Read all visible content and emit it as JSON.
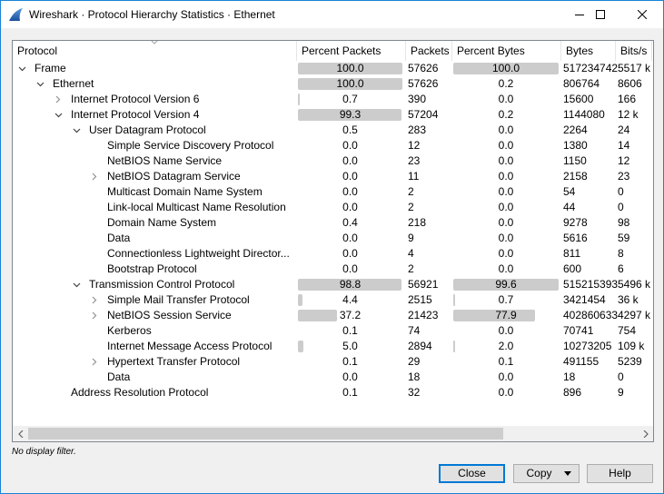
{
  "window": {
    "title": "Wireshark · Protocol Hierarchy Statistics · Ethernet",
    "app_icon": "wireshark-fin-icon",
    "accent_color": "#0078d7"
  },
  "table": {
    "columns": [
      "Protocol",
      "Percent Packets",
      "Packets",
      "Percent Bytes",
      "Bytes",
      "Bits/s"
    ],
    "rows": [
      {
        "level": 0,
        "expander": "expanded",
        "protocol": "Frame",
        "pct_packets": "100.0",
        "pct_packets_value": 100.0,
        "packets": "57626",
        "pct_bytes": "100.0",
        "pct_bytes_value": 100.0,
        "bytes": "517234742",
        "bits_s": "5517 k"
      },
      {
        "level": 1,
        "expander": "expanded",
        "protocol": "Ethernet",
        "pct_packets": "100.0",
        "pct_packets_value": 100.0,
        "packets": "57626",
        "pct_bytes": "0.2",
        "pct_bytes_value": 0.2,
        "bytes": "806764",
        "bits_s": "8606"
      },
      {
        "level": 2,
        "expander": "collapsed",
        "protocol": "Internet Protocol Version 6",
        "pct_packets": "0.7",
        "pct_packets_value": 0.7,
        "packets": "390",
        "pct_bytes": "0.0",
        "pct_bytes_value": 0.0,
        "bytes": "15600",
        "bits_s": "166"
      },
      {
        "level": 2,
        "expander": "expanded",
        "protocol": "Internet Protocol Version 4",
        "pct_packets": "99.3",
        "pct_packets_value": 99.3,
        "packets": "57204",
        "pct_bytes": "0.2",
        "pct_bytes_value": 0.2,
        "bytes": "1144080",
        "bits_s": "12 k"
      },
      {
        "level": 3,
        "expander": "expanded",
        "protocol": "User Datagram Protocol",
        "pct_packets": "0.5",
        "pct_packets_value": 0.5,
        "packets": "283",
        "pct_bytes": "0.0",
        "pct_bytes_value": 0.0,
        "bytes": "2264",
        "bits_s": "24"
      },
      {
        "level": 4,
        "expander": "none",
        "protocol": "Simple Service Discovery Protocol",
        "pct_packets": "0.0",
        "pct_packets_value": 0.0,
        "packets": "12",
        "pct_bytes": "0.0",
        "pct_bytes_value": 0.0,
        "bytes": "1380",
        "bits_s": "14"
      },
      {
        "level": 4,
        "expander": "none",
        "protocol": "NetBIOS Name Service",
        "pct_packets": "0.0",
        "pct_packets_value": 0.0,
        "packets": "23",
        "pct_bytes": "0.0",
        "pct_bytes_value": 0.0,
        "bytes": "1150",
        "bits_s": "12"
      },
      {
        "level": 4,
        "expander": "collapsed",
        "protocol": "NetBIOS Datagram Service",
        "pct_packets": "0.0",
        "pct_packets_value": 0.0,
        "packets": "11",
        "pct_bytes": "0.0",
        "pct_bytes_value": 0.0,
        "bytes": "2158",
        "bits_s": "23"
      },
      {
        "level": 4,
        "expander": "none",
        "protocol": "Multicast Domain Name System",
        "pct_packets": "0.0",
        "pct_packets_value": 0.0,
        "packets": "2",
        "pct_bytes": "0.0",
        "pct_bytes_value": 0.0,
        "bytes": "54",
        "bits_s": "0"
      },
      {
        "level": 4,
        "expander": "none",
        "protocol": "Link-local Multicast Name Resolution",
        "pct_packets": "0.0",
        "pct_packets_value": 0.0,
        "packets": "2",
        "pct_bytes": "0.0",
        "pct_bytes_value": 0.0,
        "bytes": "44",
        "bits_s": "0"
      },
      {
        "level": 4,
        "expander": "none",
        "protocol": "Domain Name System",
        "pct_packets": "0.4",
        "pct_packets_value": 0.4,
        "packets": "218",
        "pct_bytes": "0.0",
        "pct_bytes_value": 0.0,
        "bytes": "9278",
        "bits_s": "98"
      },
      {
        "level": 4,
        "expander": "none",
        "protocol": "Data",
        "pct_packets": "0.0",
        "pct_packets_value": 0.0,
        "packets": "9",
        "pct_bytes": "0.0",
        "pct_bytes_value": 0.0,
        "bytes": "5616",
        "bits_s": "59"
      },
      {
        "level": 4,
        "expander": "none",
        "protocol": "Connectionless Lightweight Director...",
        "pct_packets": "0.0",
        "pct_packets_value": 0.0,
        "packets": "4",
        "pct_bytes": "0.0",
        "pct_bytes_value": 0.0,
        "bytes": "811",
        "bits_s": "8"
      },
      {
        "level": 4,
        "expander": "none",
        "protocol": "Bootstrap Protocol",
        "pct_packets": "0.0",
        "pct_packets_value": 0.0,
        "packets": "2",
        "pct_bytes": "0.0",
        "pct_bytes_value": 0.0,
        "bytes": "600",
        "bits_s": "6"
      },
      {
        "level": 3,
        "expander": "expanded",
        "protocol": "Transmission Control Protocol",
        "pct_packets": "98.8",
        "pct_packets_value": 98.8,
        "packets": "56921",
        "pct_bytes": "99.6",
        "pct_bytes_value": 99.6,
        "bytes": "515215393",
        "bits_s": "5496 k"
      },
      {
        "level": 4,
        "expander": "collapsed",
        "protocol": "Simple Mail Transfer Protocol",
        "pct_packets": "4.4",
        "pct_packets_value": 4.4,
        "packets": "2515",
        "pct_bytes": "0.7",
        "pct_bytes_value": 0.7,
        "bytes": "3421454",
        "bits_s": "36 k"
      },
      {
        "level": 4,
        "expander": "collapsed",
        "protocol": "NetBIOS Session Service",
        "pct_packets": "37.2",
        "pct_packets_value": 37.2,
        "packets": "21423",
        "pct_bytes": "77.9",
        "pct_bytes_value": 77.9,
        "bytes": "402860633",
        "bits_s": "4297 k"
      },
      {
        "level": 4,
        "expander": "none",
        "protocol": "Kerberos",
        "pct_packets": "0.1",
        "pct_packets_value": 0.1,
        "packets": "74",
        "pct_bytes": "0.0",
        "pct_bytes_value": 0.0,
        "bytes": "70741",
        "bits_s": "754"
      },
      {
        "level": 4,
        "expander": "none",
        "protocol": "Internet Message Access Protocol",
        "pct_packets": "5.0",
        "pct_packets_value": 5.0,
        "packets": "2894",
        "pct_bytes": "2.0",
        "pct_bytes_value": 2.0,
        "bytes": "10273205",
        "bits_s": "109 k"
      },
      {
        "level": 4,
        "expander": "collapsed",
        "protocol": "Hypertext Transfer Protocol",
        "pct_packets": "0.1",
        "pct_packets_value": 0.1,
        "packets": "29",
        "pct_bytes": "0.1",
        "pct_bytes_value": 0.1,
        "bytes": "491155",
        "bits_s": "5239"
      },
      {
        "level": 4,
        "expander": "none",
        "protocol": "Data",
        "pct_packets": "0.0",
        "pct_packets_value": 0.0,
        "packets": "18",
        "pct_bytes": "0.0",
        "pct_bytes_value": 0.0,
        "bytes": "18",
        "bits_s": "0"
      },
      {
        "level": 2,
        "expander": "none",
        "protocol": "Address Resolution Protocol",
        "pct_packets": "0.1",
        "pct_packets_value": 0.1,
        "packets": "32",
        "pct_bytes": "0.0",
        "pct_bytes_value": 0.0,
        "bytes": "896",
        "bits_s": "9"
      }
    ]
  },
  "status": {
    "display_filter": "No display filter."
  },
  "buttons": {
    "close": "Close",
    "copy": "Copy",
    "help": "Help"
  }
}
